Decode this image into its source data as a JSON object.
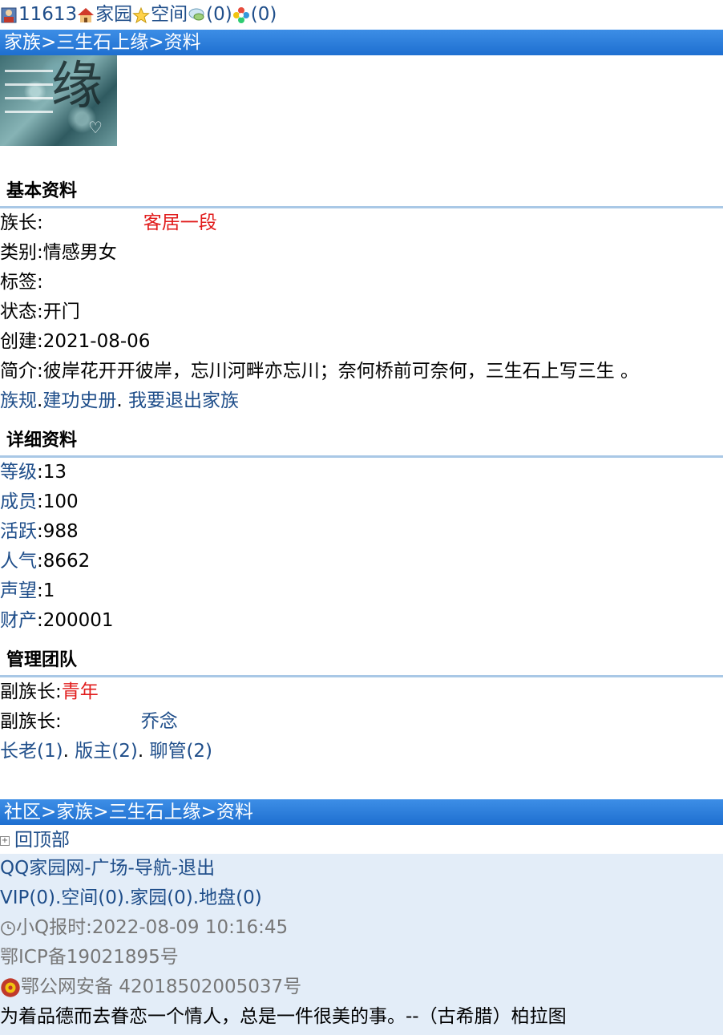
{
  "topbar": {
    "user_id": "11613",
    "home": "家园",
    "space": "空间",
    "msg_count": "(0)",
    "other_count": "(0)"
  },
  "breadcrumb_top": {
    "items": [
      "家族",
      "三生石上缘",
      "资料"
    ],
    "sep": ">"
  },
  "basic": {
    "title": "基本资料",
    "leader_label": "族长:",
    "leader_name": "客居一段",
    "category_label": "类别:",
    "category_value": "情感男女",
    "tags_label": "标签:",
    "status_label": "状态:",
    "status_value": "开门",
    "created_label": "创建:",
    "created_value": "2021-08-06",
    "intro_label": "简介:",
    "intro_value": "彼岸花开开彼岸，忘川河畔亦忘川；奈何桥前可奈何，三生石上写三生 。",
    "links": [
      "族规",
      "建功史册",
      "我要退出家族"
    ]
  },
  "detail": {
    "title": "详细资料",
    "items": [
      {
        "label": "等级",
        "value": ":13"
      },
      {
        "label": "成员",
        "value": ":100"
      },
      {
        "label": "活跃",
        "value": ":988"
      },
      {
        "label": "人气",
        "value": ":8662"
      },
      {
        "label": "声望",
        "value": ":1"
      },
      {
        "label": "财产",
        "value": ":200001"
      }
    ]
  },
  "management": {
    "title": "管理团队",
    "vice1_label": "副族长:",
    "vice1_name": "青年",
    "vice2_label": "副族长:",
    "vice2_name": "乔念",
    "roles": [
      "长老(1)",
      "版主(2)",
      "聊管(2)"
    ]
  },
  "breadcrumb_bottom": {
    "items": [
      "社区",
      "家族",
      "三生石上缘",
      "资料"
    ],
    "sep": ">"
  },
  "backtop": "回顶部",
  "footer": {
    "nav": [
      "QQ家园网",
      "广场",
      "导航",
      "退出"
    ],
    "nav_sep": "-",
    "counts": [
      "VIP(0)",
      "空间(0)",
      "家园(0)",
      "地盘(0)"
    ],
    "time_label": "小Q报时:2022-08-09 10:16:45",
    "icp": "鄂ICP备19021895号",
    "police": "鄂公网安备 42018502005037号",
    "quote": "为着品德而去眷恋一个情人，总是一件很美的事。--（古希腊）柏拉图"
  }
}
